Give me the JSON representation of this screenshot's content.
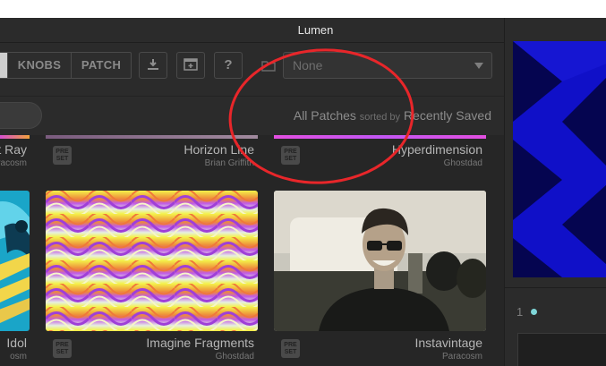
{
  "window": {
    "title": "Lumen"
  },
  "toolbar": {
    "tabs": [
      {
        "label": "",
        "selected": true
      },
      {
        "label": "KNOBS",
        "selected": false
      },
      {
        "label": "PATCH",
        "selected": false
      }
    ],
    "icons": [
      "download-icon",
      "add-window-icon",
      "help-icon",
      "folder-icon"
    ],
    "help_label": "?",
    "preset_select": {
      "value": "None"
    }
  },
  "filter": {
    "scope": "All Patches",
    "sorted_by_label": "sorted by",
    "sort": "Recently Saved"
  },
  "patches": {
    "row1": [
      {
        "name": "t Ray",
        "author": "aracosm"
      },
      {
        "name": "Horizon Line",
        "author": "Brian Griffith"
      },
      {
        "name": "Hyperdimension",
        "author": "Ghostdad"
      }
    ],
    "row2": [
      {
        "name": "Idol",
        "author": "osm"
      },
      {
        "name": "Imagine Fragments",
        "author": "Ghostdad"
      },
      {
        "name": "Instavintage",
        "author": "Paracosm"
      }
    ],
    "badge": "PRE\nSET"
  },
  "side": {
    "channel": "1"
  },
  "colors": {
    "annotation_circle": "#e8262a",
    "channel_dot": "#7fd6d8"
  }
}
